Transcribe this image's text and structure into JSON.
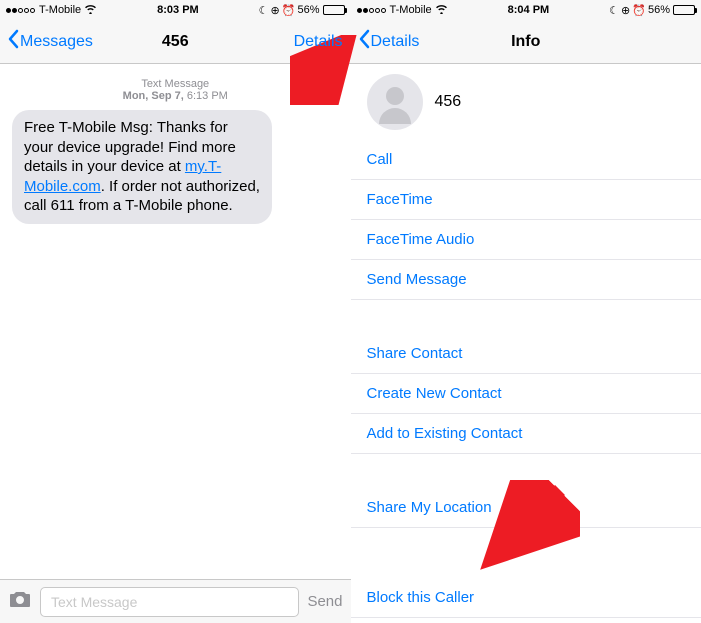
{
  "left": {
    "status": {
      "carrier": "T-Mobile",
      "time": "8:03 PM",
      "battery": "56%"
    },
    "nav": {
      "back": "Messages",
      "title": "456",
      "right": "Details"
    },
    "stamp": {
      "type": "Text Message",
      "day": "Mon, Sep 7,",
      "time": "6:13 PM"
    },
    "message": {
      "pre": "Free T-Mobile Msg: Thanks for your device upgrade! Find more details in your device at ",
      "link": "my.T-Mobile.com",
      "post": ". If order not authorized, call 611 from a T-Mobile phone."
    },
    "input": {
      "placeholder": "Text Message",
      "send": "Send"
    }
  },
  "right": {
    "status": {
      "carrier": "T-Mobile",
      "time": "8:04 PM",
      "battery": "56%"
    },
    "nav": {
      "back": "Details",
      "title": "Info"
    },
    "contact": {
      "name": "456"
    },
    "actions1": [
      "Call",
      "FaceTime",
      "FaceTime Audio",
      "Send Message"
    ],
    "actions2": [
      "Share Contact",
      "Create New Contact",
      "Add to Existing Contact"
    ],
    "actions3": [
      "Share My Location"
    ],
    "actions4": [
      "Block this Caller"
    ]
  }
}
